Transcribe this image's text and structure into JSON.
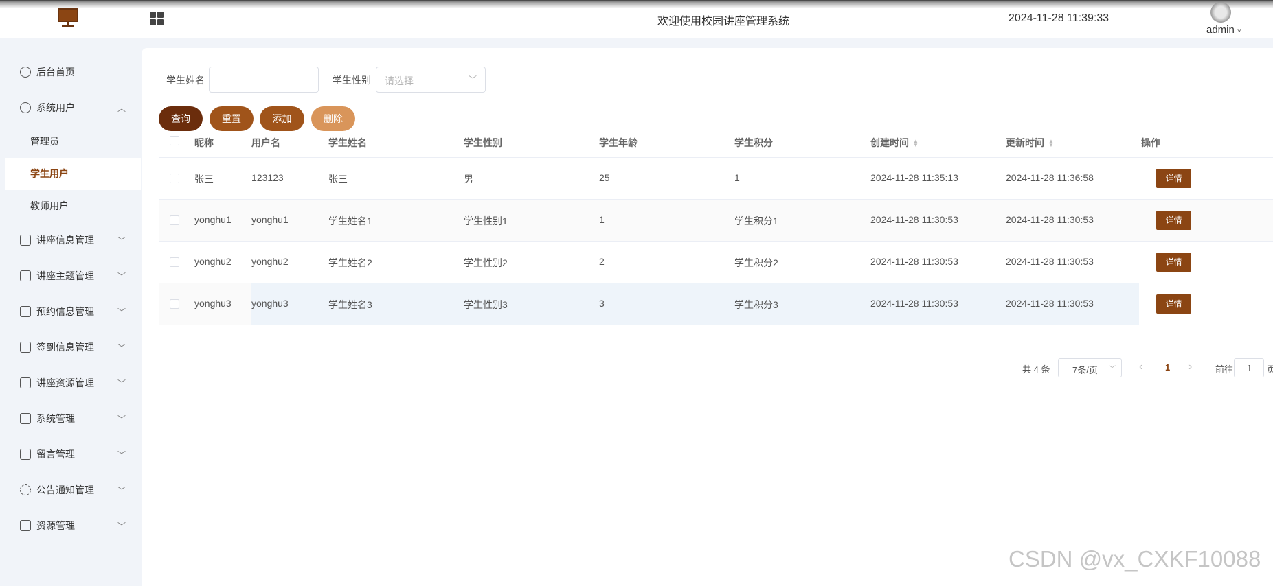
{
  "header": {
    "title": "欢迎使用校园讲座管理系统",
    "datetime": "2024-11-28 11:39:33",
    "user": "admin"
  },
  "sidebar": {
    "items": [
      {
        "label": "后台首页",
        "icon": "dashboard-icon"
      },
      {
        "label": "系统用户",
        "icon": "user-icon",
        "expanded": true,
        "children": [
          "管理员",
          "学生用户",
          "教师用户"
        ],
        "active_child": "学生用户"
      },
      {
        "label": "讲座信息管理",
        "icon": "card-icon"
      },
      {
        "label": "讲座主题管理",
        "icon": "card-icon"
      },
      {
        "label": "预约信息管理",
        "icon": "card-icon"
      },
      {
        "label": "签到信息管理",
        "icon": "card-icon"
      },
      {
        "label": "讲座资源管理",
        "icon": "card-icon"
      },
      {
        "label": "系统管理",
        "icon": "checkbox-icon"
      },
      {
        "label": "留言管理",
        "icon": "checkbox-icon"
      },
      {
        "label": "公告通知管理",
        "icon": "loading-icon"
      },
      {
        "label": "资源管理",
        "icon": "printer-icon"
      }
    ]
  },
  "search": {
    "name_label": "学生姓名",
    "name_value": "",
    "gender_label": "学生性别",
    "gender_placeholder": "请选择"
  },
  "buttons": {
    "query": "查询",
    "reset": "重置",
    "add": "添加",
    "delete": "删除"
  },
  "colors": {
    "query": "#6b2d0c",
    "reset": "#a0541a",
    "add": "#a0541a",
    "delete": "#d9955a",
    "accent": "#8b4513"
  },
  "table": {
    "columns": [
      "昵称",
      "用户名",
      "学生姓名",
      "学生性别",
      "学生年龄",
      "学生积分",
      "创建时间",
      "更新时间",
      "操作"
    ],
    "detail_label": "详情",
    "rows": [
      [
        "张三",
        "123123",
        "张三",
        "男",
        "25",
        "1",
        "2024-11-28 11:35:13",
        "2024-11-28 11:36:58"
      ],
      [
        "yonghu1",
        "yonghu1",
        "学生姓名1",
        "学生性别1",
        "1",
        "学生积分1",
        "2024-11-28 11:30:53",
        "2024-11-28 11:30:53"
      ],
      [
        "yonghu2",
        "yonghu2",
        "学生姓名2",
        "学生性别2",
        "2",
        "学生积分2",
        "2024-11-28 11:30:53",
        "2024-11-28 11:30:53"
      ],
      [
        "yonghu3",
        "yonghu3",
        "学生姓名3",
        "学生性别3",
        "3",
        "学生积分3",
        "2024-11-28 11:30:53",
        "2024-11-28 11:30:53"
      ]
    ]
  },
  "pagination": {
    "total": "共 4 条",
    "page_size": "7条/页",
    "current": "1",
    "goto_label": "前往",
    "goto_value": "1",
    "page_suffix": "页"
  },
  "watermark": "CSDN @vx_CXKF10088"
}
